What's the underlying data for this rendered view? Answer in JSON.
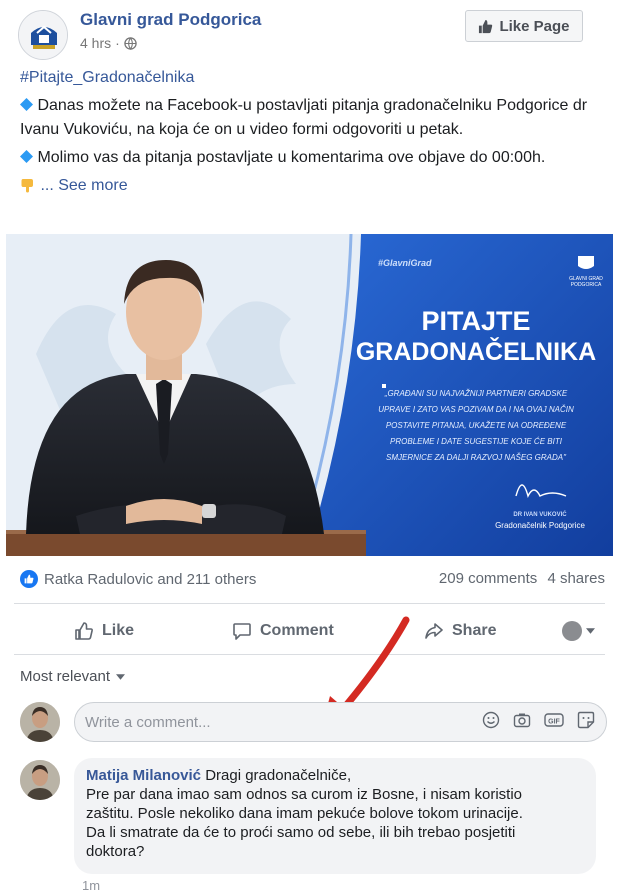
{
  "header": {
    "page_name": "Glavni grad Podgorica",
    "time": "4 hrs",
    "like_page_label": "Like Page"
  },
  "post": {
    "hashtag": "#Pitajte_Gradonačelnika",
    "paragraph_1": "Danas možete na Facebook-u postavljati pitanja gradonačelniku Podgorice dr Ivanu Vukoviću, na koja će on u video formi odgovoriti u petak.",
    "paragraph_2": "Molimo vas da pitanja postavljate u komentarima ove objave do 00:00h.",
    "see_more": "... See more"
  },
  "banner": {
    "tag": "#GlavniGrad",
    "title_line_1": "PITAJTE",
    "title_line_2": "GRADONAČELNIKA",
    "quote": [
      "„GRAĐANI SU NAJVAŽNIJI PARTNERI GRADSKE",
      "UPRAVE I ZATO VAS POZIVAM DA I NA OVAJ NAČIN",
      "POSTAVITE PITANJA, UKAŽETE NA ODREĐENE",
      "PROBLEME I DATE SUGESTIJE KOJE ĆE BITI",
      "SMJERNICE ZA DALJI RAZVOJ NAŠEG GRADA\""
    ],
    "signer_name": "DR IVAN VUKOVIĆ",
    "signer_title": "Gradonačelnik Podgorice",
    "logo_text_1": "GLAVNI GRAD",
    "logo_text_2": "PODGORICA"
  },
  "stats": {
    "reactions": "Ratka Radulovic and 211 others",
    "comments": "209 comments",
    "shares": "4 shares"
  },
  "actions": {
    "like": "Like",
    "comment": "Comment",
    "share": "Share"
  },
  "sort": {
    "label": "Most relevant"
  },
  "composer": {
    "placeholder": "Write a comment..."
  },
  "comment": {
    "author": "Matija Milanović",
    "text_first": "Dragi gradonačelniče,",
    "lines": [
      "Pre par dana imao sam odnos sa curom iz Bosne, i nisam koristio",
      "zaštitu. Posle nekoliko dana imam pekuće bolove tokom urinacije.",
      "Da li smatrate da će to proći samo od sebe, ili bih trebao posjetiti",
      "doktora?"
    ],
    "time": "1m"
  },
  "colors": {
    "link": "#365899",
    "banner_blue": "#1a4fb8",
    "arrow_red": "#d42a22"
  }
}
